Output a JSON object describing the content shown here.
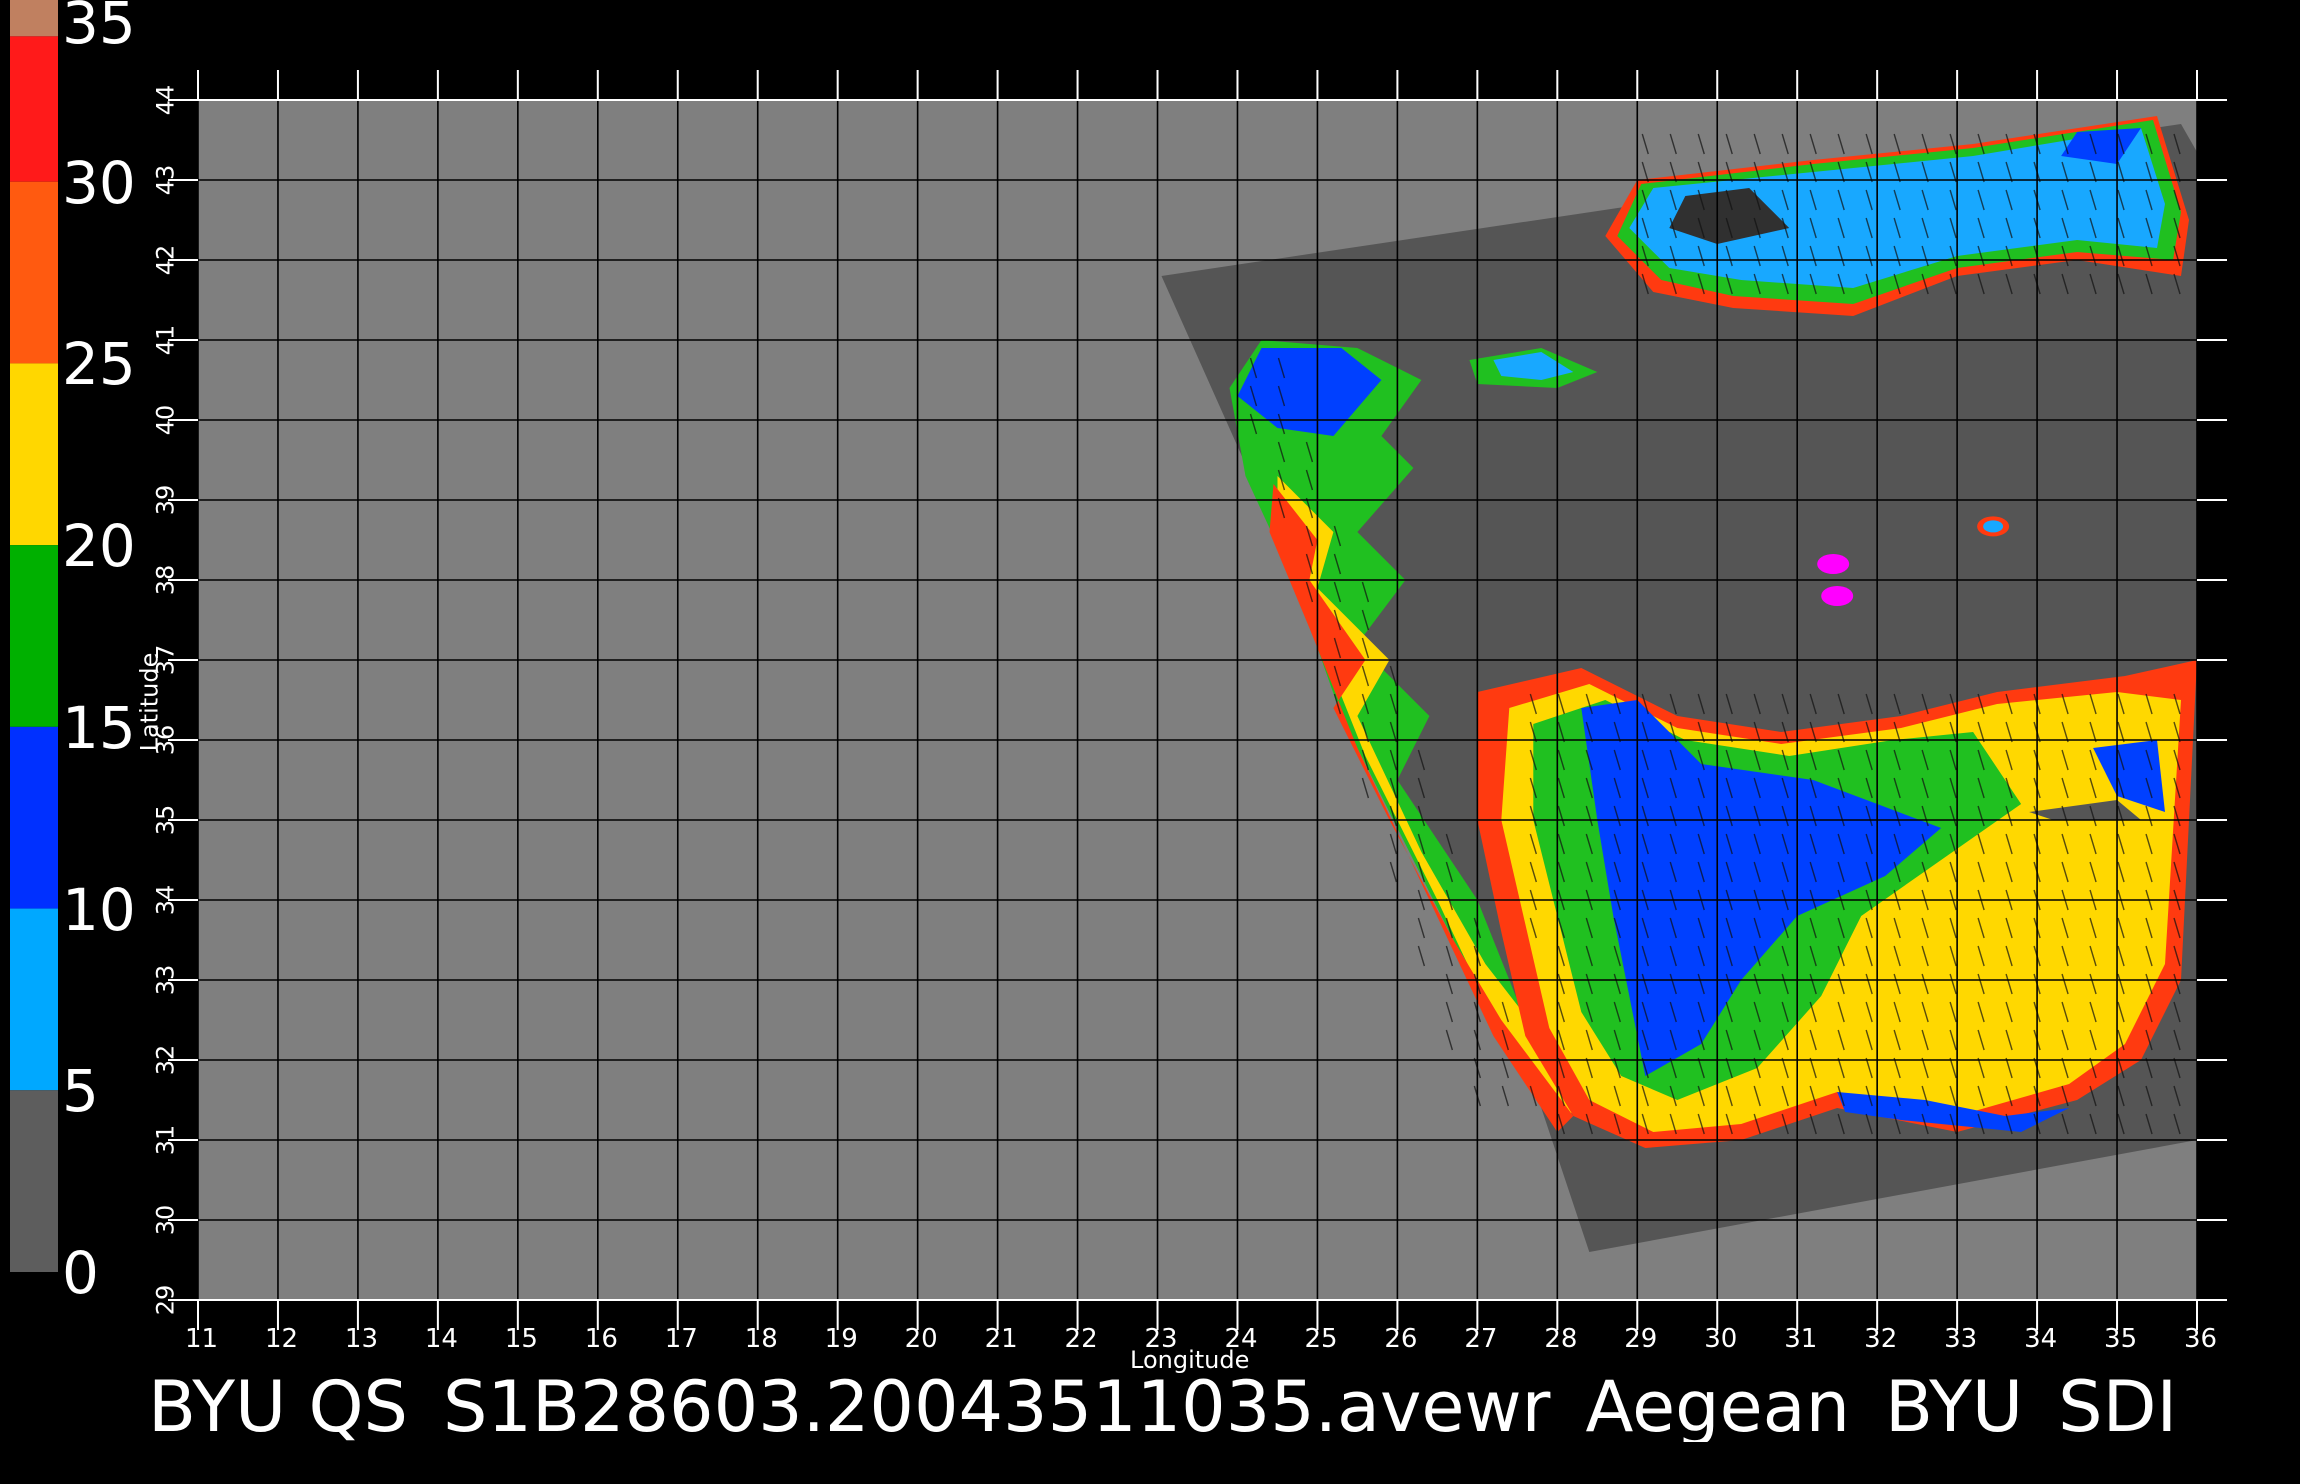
{
  "caption": "BYU  QS_S1B28603.20043511035.avewr_Aegean_BYU_SDI",
  "colorbar": {
    "labels": [
      "35",
      "30",
      "25",
      "20",
      "15",
      "10",
      "5",
      "0"
    ],
    "segments": [
      {
        "from": 35,
        "to": 34,
        "color": "#c08060"
      },
      {
        "from": 34,
        "to": 30,
        "color": "#ff1a1a"
      },
      {
        "from": 30,
        "to": 25,
        "color": "#ff5a10"
      },
      {
        "from": 25,
        "to": 20,
        "color": "#ffd700"
      },
      {
        "from": 20,
        "to": 15,
        "color": "#00b000"
      },
      {
        "from": 15,
        "to": 10,
        "color": "#0030ff"
      },
      {
        "from": 10,
        "to": 5,
        "color": "#00a8ff"
      },
      {
        "from": 5,
        "to": 0,
        "color": "#505050"
      }
    ]
  },
  "map": {
    "background_color": "#7f7f7f",
    "swath_color": "#555555",
    "grid_color": "#000000",
    "lon_range": [
      11,
      36
    ],
    "lat_range": [
      29,
      44
    ],
    "lon_ticks": [
      "11",
      "12",
      "13",
      "14",
      "15",
      "16",
      "17",
      "18",
      "19",
      "20",
      "21",
      "22",
      "23",
      "24",
      "25",
      "26",
      "27",
      "28",
      "29",
      "30",
      "31",
      "32",
      "33",
      "34",
      "35",
      "36"
    ],
    "lat_ticks": [
      "29",
      "30",
      "31",
      "32",
      "33",
      "34",
      "35",
      "36",
      "37",
      "38",
      "39",
      "40",
      "41",
      "42",
      "43",
      "44"
    ],
    "xlabel": "Longitude",
    "ylabel": "Latitude"
  },
  "colors": {
    "low_wind": "#0040ff",
    "light_wind": "#18a8ff",
    "moderate_wind": "#20c020",
    "fresh_wind": "#ffd800",
    "strong_wind": "#ff3a10",
    "coastal_edge": "#ff00ff"
  }
}
